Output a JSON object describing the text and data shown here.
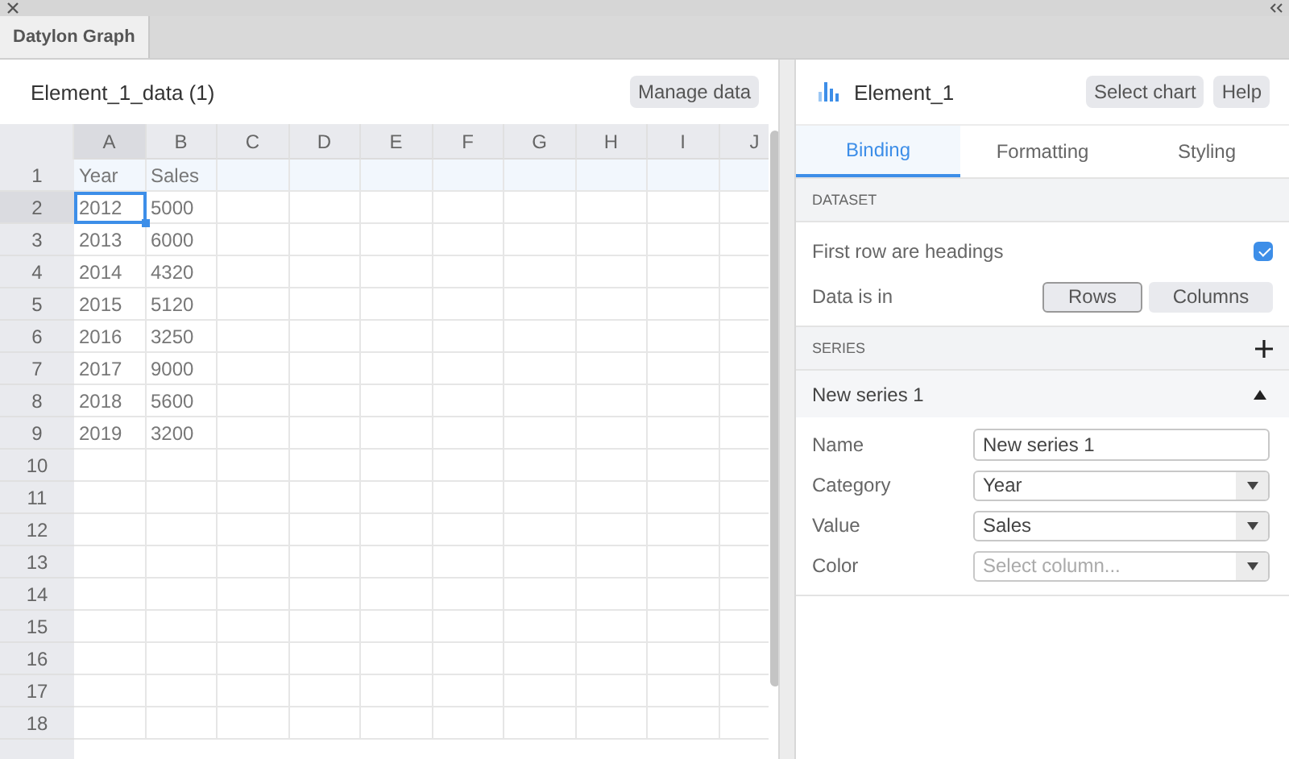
{
  "app_tabs": [
    {
      "label": "Datylon Graph",
      "selected": true
    }
  ],
  "sheet": {
    "title": "Element_1_data (1)",
    "button": "Manage data",
    "columns": [
      {
        "label": "A",
        "selected": true
      },
      {
        "label": "B",
        "selected": false
      },
      {
        "label": "C",
        "selected": false
      },
      {
        "label": "D",
        "selected": false
      },
      {
        "label": "E",
        "selected": false
      },
      {
        "label": "F",
        "selected": false
      },
      {
        "label": "G",
        "selected": false
      },
      {
        "label": "H",
        "selected": false
      },
      {
        "label": "I",
        "selected": false
      },
      {
        "label": "J",
        "selected": false
      }
    ],
    "rows": [
      {
        "number": "1",
        "selected": false,
        "cells": [
          {
            "text": "Year",
            "selected": false
          },
          {
            "text": "Sales",
            "selected": false
          }
        ]
      },
      {
        "number": "2",
        "selected": true,
        "cells": [
          {
            "text": "2012",
            "selected": true
          },
          {
            "text": "5000",
            "selected": false
          }
        ]
      },
      {
        "number": "3",
        "selected": false,
        "cells": [
          {
            "text": "2013",
            "selected": false
          },
          {
            "text": "6000",
            "selected": false
          }
        ]
      },
      {
        "number": "4",
        "selected": false,
        "cells": [
          {
            "text": "2014",
            "selected": false
          },
          {
            "text": "4320",
            "selected": false
          }
        ]
      },
      {
        "number": "5",
        "selected": false,
        "cells": [
          {
            "text": "2015",
            "selected": false
          },
          {
            "text": "5120",
            "selected": false
          }
        ]
      },
      {
        "number": "6",
        "selected": false,
        "cells": [
          {
            "text": "2016",
            "selected": false
          },
          {
            "text": "3250",
            "selected": false
          }
        ]
      },
      {
        "number": "7",
        "selected": false,
        "cells": [
          {
            "text": "2017",
            "selected": false
          },
          {
            "text": "9000",
            "selected": false
          }
        ]
      },
      {
        "number": "8",
        "selected": false,
        "cells": [
          {
            "text": "2018",
            "selected": false
          },
          {
            "text": "5600",
            "selected": false
          }
        ]
      },
      {
        "number": "9",
        "selected": false,
        "cells": [
          {
            "text": "2019",
            "selected": false
          },
          {
            "text": "3200",
            "selected": false
          }
        ]
      },
      {
        "number": "10",
        "selected": false
      },
      {
        "number": "11",
        "selected": false
      },
      {
        "number": "12",
        "selected": false
      },
      {
        "number": "13",
        "selected": false
      },
      {
        "number": "14",
        "selected": false
      },
      {
        "number": "15",
        "selected": false
      },
      {
        "number": "16",
        "selected": false
      },
      {
        "number": "17",
        "selected": false
      },
      {
        "number": "18",
        "selected": false
      }
    ]
  },
  "panel": {
    "title": "Element_1",
    "buttons": [
      "Select chart",
      "Help"
    ],
    "tabs": [
      {
        "label": "Binding",
        "selected": true
      },
      {
        "label": "Formatting",
        "selected": false
      },
      {
        "label": "Styling",
        "selected": false
      }
    ],
    "dataset": {
      "heading": "DATASET",
      "first_row_headings": {
        "label": "First row are headings",
        "checked": true
      },
      "data_is_in": {
        "label": "Data is in",
        "options": [
          {
            "label": "Rows",
            "selected": true
          },
          {
            "label": "Columns",
            "selected": false
          }
        ]
      }
    },
    "series": {
      "heading": "SERIES",
      "items": [
        {
          "title": "New series 1",
          "expanded": true,
          "fields": [
            {
              "label": "Name",
              "kind": "text",
              "value": "New series 1"
            },
            {
              "label": "Category",
              "kind": "select",
              "value": "Year"
            },
            {
              "label": "Value",
              "kind": "select",
              "value": "Sales"
            },
            {
              "label": "Color",
              "kind": "select",
              "placeholder": "Select column..."
            }
          ]
        }
      ]
    }
  }
}
